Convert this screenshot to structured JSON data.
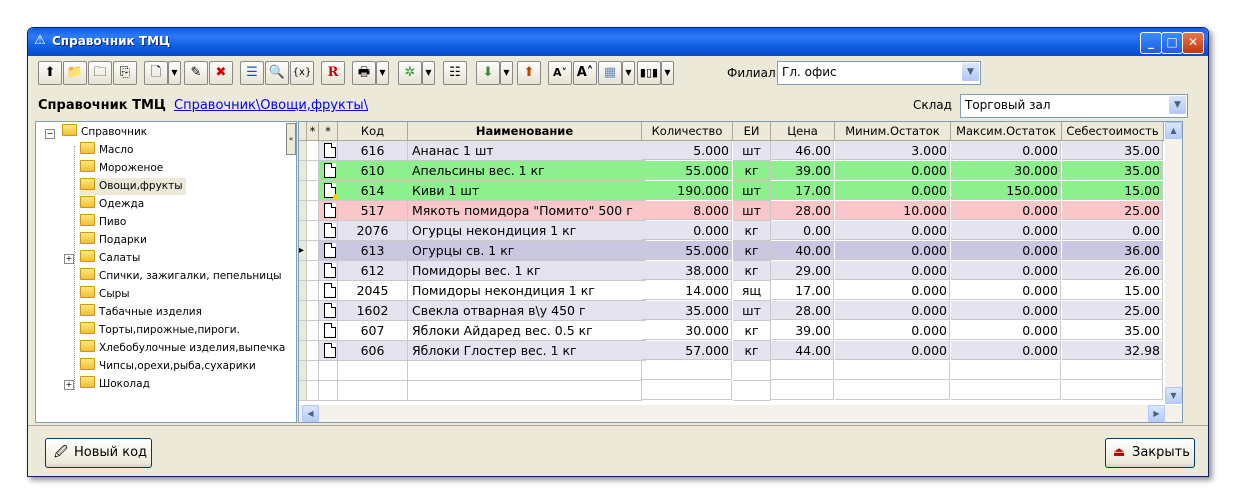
{
  "window": {
    "title": "Справочник ТМЦ"
  },
  "toolbar": {
    "filial_label": "Филиал",
    "filial_value": "Гл. офис"
  },
  "header": {
    "title": "Справочник ТМЦ",
    "breadcrumb": "Справочник\\Овощи,фрукты\\",
    "sklad_label": "Склад",
    "sklad_value": "Торговый зал"
  },
  "tree": {
    "root": "Справочник",
    "items": [
      "Масло",
      "Мороженое",
      "Овощи,фрукты",
      "Одежда",
      "Пиво",
      "Подарки",
      "Салаты",
      "Спички, зажигалки, пепельницы",
      "Сыры",
      "Табачные изделия",
      "Торты,пирожные,пироги.",
      "Хлебобулочные изделия,выпечка",
      "Чипсы,орехи,рыба,сухарики",
      "Шоколад"
    ],
    "selected": "Овощи,фрукты"
  },
  "grid": {
    "columns": [
      "*",
      "*",
      "Код",
      "Наименование",
      "Количество",
      "ЕИ",
      "Цена",
      "Миним.Остаток",
      "Максим.Остаток",
      "Себестоимость"
    ],
    "rows": [
      {
        "code": "616",
        "name": "Ананас 1 шт",
        "qty": "5.000",
        "unit": "шт",
        "price": "46.00",
        "min": "3.000",
        "max": "0.000",
        "cost": "35.00",
        "color": "#e4e3ef",
        "icon": "doc"
      },
      {
        "code": "610",
        "name": "Апельсины вес. 1 кг",
        "qty": "55.000",
        "unit": "кг",
        "price": "39.00",
        "min": "0.000",
        "max": "30.000",
        "cost": "35.00",
        "color": "#8cf08c",
        "icon": "doc"
      },
      {
        "code": "614",
        "name": "Киви 1 шт",
        "qty": "190.000",
        "unit": "шт",
        "price": "17.00",
        "min": "0.000",
        "max": "150.000",
        "cost": "15.00",
        "color": "#8cf08c",
        "icon": "doc-plus"
      },
      {
        "code": "517",
        "name": "Мякоть помидора \"Помито\" 500 г",
        "qty": "8.000",
        "unit": "шт",
        "price": "28.00",
        "min": "10.000",
        "max": "0.000",
        "cost": "25.00",
        "color": "#f9c7c9",
        "icon": "doc"
      },
      {
        "code": "2076",
        "name": "Огурцы некондиция 1 кг",
        "qty": "0.000",
        "unit": "кг",
        "price": "0.00",
        "min": "0.000",
        "max": "0.000",
        "cost": "0.00",
        "color": "#e4e3ef",
        "icon": "doc"
      },
      {
        "code": "613",
        "name": "Огурцы св. 1 кг",
        "qty": "55.000",
        "unit": "кг",
        "price": "40.00",
        "min": "0.000",
        "max": "0.000",
        "cost": "36.00",
        "color": "#c9c8e0",
        "icon": "doc",
        "current": true
      },
      {
        "code": "612",
        "name": "Помидоры вес. 1 кг",
        "qty": "38.000",
        "unit": "кг",
        "price": "29.00",
        "min": "0.000",
        "max": "0.000",
        "cost": "26.00",
        "color": "#e4e3ef",
        "icon": "doc"
      },
      {
        "code": "2045",
        "name": "Помидоры некондиция 1 кг",
        "qty": "14.000",
        "unit": "ящ",
        "price": "17.00",
        "min": "0.000",
        "max": "0.000",
        "cost": "15.00",
        "color": "#ffffff",
        "icon": "doc"
      },
      {
        "code": "1602",
        "name": "Свекла отварная в\\у 450 г",
        "qty": "35.000",
        "unit": "шт",
        "price": "28.00",
        "min": "0.000",
        "max": "0.000",
        "cost": "25.00",
        "color": "#e4e3ef",
        "icon": "doc"
      },
      {
        "code": "607",
        "name": "Яблоки Айдаред вес. 0.5 кг",
        "qty": "30.000",
        "unit": "кг",
        "price": "39.00",
        "min": "0.000",
        "max": "0.000",
        "cost": "35.00",
        "color": "#ffffff",
        "icon": "doc"
      },
      {
        "code": "606",
        "name": "Яблоки Глостер вес. 1 кг",
        "qty": "57.000",
        "unit": "кг",
        "price": "44.00",
        "min": "0.000",
        "max": "0.000",
        "cost": "32.98",
        "color": "#e4e3ef",
        "icon": "doc"
      }
    ]
  },
  "footer": {
    "new_code_label": "Новый код",
    "close_label": "Закрыть"
  }
}
